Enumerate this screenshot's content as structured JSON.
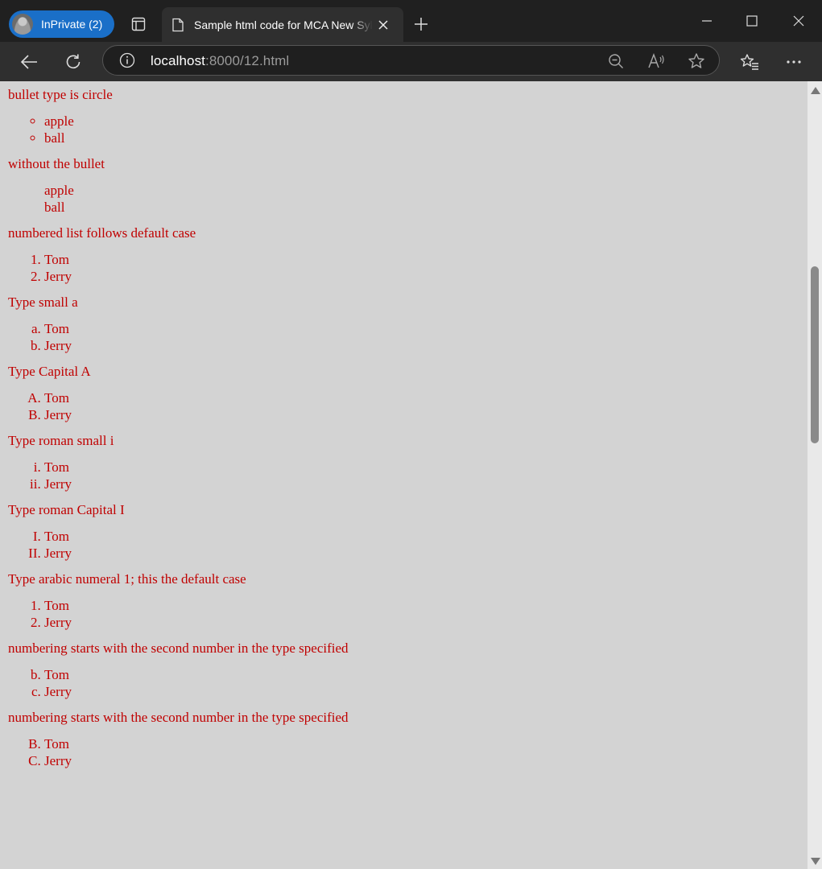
{
  "browser": {
    "profile_label": "InPrivate (2)",
    "tab_title": "Sample html code for MCA New Syllabus",
    "url_host": "localhost",
    "url_rest": ":8000/12.html"
  },
  "page": {
    "sections": [
      {
        "heading": "bullet type is circle",
        "list_type": "circle",
        "items": [
          "apple",
          "ball"
        ]
      },
      {
        "heading": "without the bullet",
        "list_type": "none",
        "items": [
          "apple",
          "ball"
        ]
      },
      {
        "heading": "numbered list follows default case",
        "list_type": "1",
        "start": 1,
        "items": [
          "Tom",
          "Jerry"
        ]
      },
      {
        "heading": "Type small a",
        "list_type": "a",
        "start": 1,
        "items": [
          "Tom",
          "Jerry"
        ]
      },
      {
        "heading": "Type Capital A",
        "list_type": "A",
        "start": 1,
        "items": [
          "Tom",
          "Jerry"
        ]
      },
      {
        "heading": "Type roman small i",
        "list_type": "i",
        "start": 1,
        "items": [
          "Tom",
          "Jerry"
        ]
      },
      {
        "heading": "Type roman Capital I",
        "list_type": "I",
        "start": 1,
        "items": [
          "Tom",
          "Jerry"
        ]
      },
      {
        "heading": "Type arabic numeral 1; this the default case",
        "list_type": "1",
        "start": 1,
        "items": [
          "Tom",
          "Jerry"
        ]
      },
      {
        "heading": "numbering starts with the second number in the type specified",
        "list_type": "a",
        "start": 2,
        "items": [
          "Tom",
          "Jerry"
        ]
      },
      {
        "heading": "numbering starts with the second number in the type specified",
        "list_type": "A",
        "start": 2,
        "items": [
          "Tom",
          "Jerry"
        ]
      }
    ]
  },
  "colors": {
    "page_background": "#d3d3d3",
    "text": "#c00000",
    "profile_pill": "#1a6fc8"
  }
}
